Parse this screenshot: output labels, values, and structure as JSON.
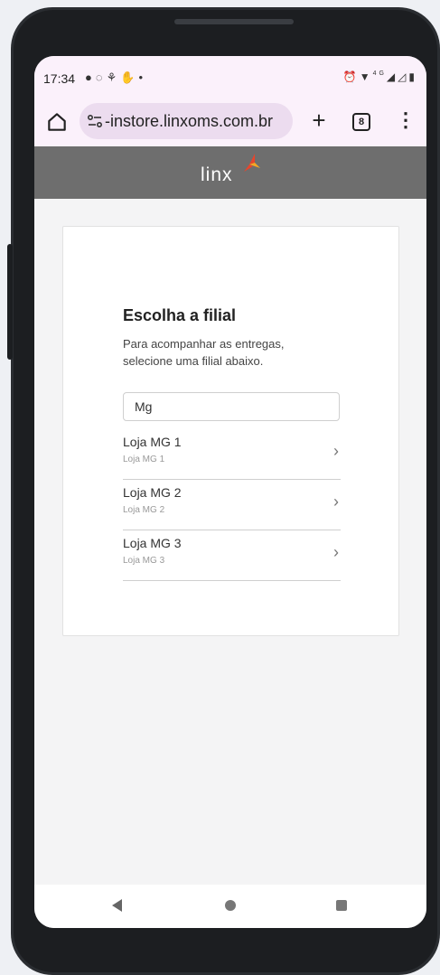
{
  "status_bar": {
    "time": "17:34",
    "left_icons": [
      "message-icon",
      "whatsapp-icon",
      "app-icon",
      "app-icon",
      "dot-icon"
    ],
    "right_icons": [
      "alarm-icon",
      "wifi-icon",
      "4g-icon",
      "signal-icon",
      "signal-icon",
      "battery-icon"
    ],
    "network_label": "4G"
  },
  "browser": {
    "url": "-instore.linxoms.com.br",
    "tab_count": "8",
    "plus_label": "+",
    "menu_label": "⋮"
  },
  "header": {
    "logo_text": "Linx",
    "accent_colors": [
      "#e8452c",
      "#f5a623"
    ]
  },
  "card": {
    "title": "Escolha a filial",
    "description": "Para acompanhar as entregas, selecione uma filial abaixo.",
    "search_value": "Mg",
    "stores": [
      {
        "name": "Loja MG 1",
        "subtitle": "Loja MG 1"
      },
      {
        "name": "Loja MG 2",
        "subtitle": "Loja MG 2"
      },
      {
        "name": "Loja MG 3",
        "subtitle": "Loja MG 3"
      }
    ]
  },
  "colors": {
    "header_bg": "#6e6e6e",
    "browser_bg": "#fbf1fb",
    "url_bg": "#ecdcef"
  }
}
